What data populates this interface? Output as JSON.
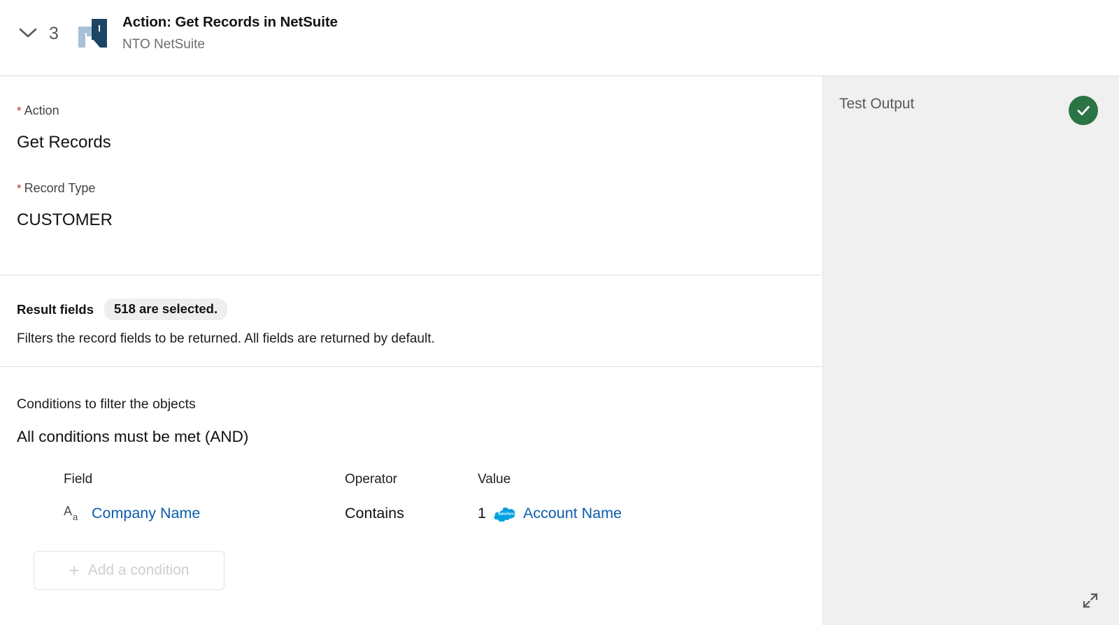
{
  "header": {
    "collapse_icon": "chevron-down-icon",
    "step_number": "3",
    "app_logo": "netsuite-logo",
    "title": "Action: Get Records in NetSuite",
    "subtitle": "NTO NetSuite"
  },
  "fields": {
    "action": {
      "required_marker": "*",
      "label": "Action",
      "value": "Get Records"
    },
    "record_type": {
      "required_marker": "*",
      "label": "Record Type",
      "value": "CUSTOMER"
    }
  },
  "result_fields": {
    "title": "Result fields",
    "badge": "518 are selected.",
    "description": "Filters the record fields to be returned. All fields are returned by default."
  },
  "conditions": {
    "caption": "Conditions to filter the objects",
    "logic": "All conditions must be met (AND)",
    "columns": {
      "field": "Field",
      "operator": "Operator",
      "value": "Value"
    },
    "rows": [
      {
        "field_icon": "text-field-icon",
        "field": "Company Name",
        "operator": "Contains",
        "value_index": "1",
        "value_icon": "salesforce-cloud-icon",
        "value": "Account Name"
      }
    ],
    "add_button": {
      "icon": "plus-icon",
      "label": "Add a condition"
    }
  },
  "test_output": {
    "title": "Test Output",
    "status_icon": "check-circle-icon",
    "status_color": "#2a7446",
    "expand_icon": "expand-diagonal-icon"
  },
  "colors": {
    "link": "#0b5cab",
    "required": "#a8392f",
    "panel_bg": "#f0f0f0",
    "success": "#2a7446"
  }
}
